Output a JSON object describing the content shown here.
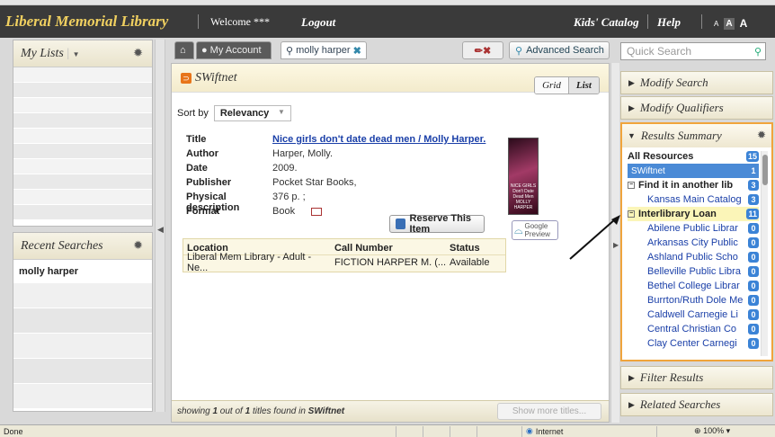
{
  "app": {
    "title": "Liberal Memorial Library",
    "welcome": "Welcome ***",
    "logout": "Logout",
    "kids_catalog": "Kids' Catalog",
    "help": "Help",
    "font_small": "A",
    "font_medium": "A",
    "font_large": "A"
  },
  "left": {
    "my_lists": "My Lists",
    "recent_searches": "Recent Searches",
    "recent_items": [
      "molly harper"
    ]
  },
  "tabs": {
    "account": "My Account",
    "search": "molly harper",
    "advanced": "Advanced Search",
    "quick_search_placeholder": "Quick Search"
  },
  "results": {
    "source": "SWiftnet",
    "view_grid": "Grid",
    "view_list": "List",
    "sort_label": "Sort by",
    "sort_value": "Relevancy",
    "record": {
      "title_label": "Title",
      "title": "Nice girls don't date dead men /  Molly Harper.",
      "author_label": "Author",
      "author": "Harper, Molly.",
      "date_label": "Date",
      "date": "2009.",
      "publisher_label": "Publisher",
      "publisher": "Pocket Star Books,",
      "physdesc_label": "Physical description",
      "physdesc": "376 p. ;",
      "format_label": "Format",
      "format": "Book",
      "reserve": "Reserve This Item",
      "google_preview": "Google Preview",
      "cover_text": "NICE GIRLS Don't Date Dead Men MOLLY HARPER"
    },
    "holdings": {
      "headers": [
        "Location",
        "Call Number",
        "Status"
      ],
      "rows": [
        [
          "Liberal Mem Library - Adult - Ne...",
          "FICTION HARPER M.   (...",
          "Available"
        ]
      ]
    },
    "footer": {
      "prefix": "showing ",
      "count": "1",
      "middle": " out of ",
      "total": "1",
      "suffix": " titles found in ",
      "source": "SWiftnet"
    },
    "show_more": "Show more titles..."
  },
  "right": {
    "modify_search": "Modify Search",
    "modify_qualifiers": "Modify Qualifiers",
    "results_summary": "Results Summary",
    "filter_results": "Filter Results",
    "related_searches": "Related Searches",
    "summary_items": [
      {
        "label": "All Resources",
        "count": "15",
        "kind": "all"
      },
      {
        "label": "SWiftnet",
        "count": "1",
        "kind": "sel"
      },
      {
        "label": "Find it in another lib",
        "count": "3",
        "kind": "grp"
      },
      {
        "label": "Kansas Main Catalog",
        "count": "3",
        "kind": "sub"
      },
      {
        "label": "Interlibrary Loan",
        "count": "11",
        "kind": "grp ill"
      },
      {
        "label": "Abilene Public Librar",
        "count": "0",
        "kind": "sub"
      },
      {
        "label": "Arkansas City Public",
        "count": "0",
        "kind": "sub"
      },
      {
        "label": "Ashland Public Scho",
        "count": "0",
        "kind": "sub"
      },
      {
        "label": "Belleville Public Libra",
        "count": "0",
        "kind": "sub"
      },
      {
        "label": "Bethel College Librar",
        "count": "0",
        "kind": "sub"
      },
      {
        "label": "Burrton/Ruth Dole Me",
        "count": "0",
        "kind": "sub"
      },
      {
        "label": "Caldwell Carnegie Li",
        "count": "0",
        "kind": "sub"
      },
      {
        "label": "Central Christian Co",
        "count": "0",
        "kind": "sub"
      },
      {
        "label": "Clay Center Carnegi",
        "count": "0",
        "kind": "sub"
      }
    ]
  },
  "status": {
    "done": "Done",
    "zone": "Internet",
    "zoom": "100%"
  },
  "colors": {
    "accent": "#f0a43c",
    "topbar": "#3a3a3a",
    "title": "#f0d060",
    "link": "#1a3fa8",
    "count_badge": "#3b83d6"
  }
}
